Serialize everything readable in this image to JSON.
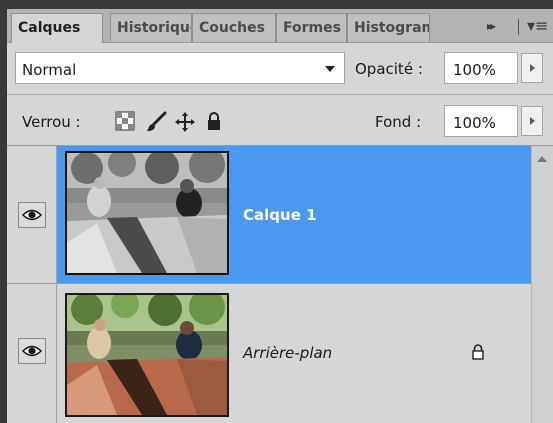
{
  "tabs": [
    {
      "label": "Calques"
    },
    {
      "label": "Historique"
    },
    {
      "label": "Couches"
    },
    {
      "label": "Formes"
    },
    {
      "label": "Histogramme"
    }
  ],
  "tab_controls": {
    "collapse": "▸▸",
    "menu": "▾≡"
  },
  "blend": {
    "mode": "Normal",
    "opacity_label": "Opacité :",
    "opacity_value": "100%"
  },
  "lock": {
    "label": "Verrou :",
    "icons": [
      "lock-transparency-icon",
      "lock-pixels-brush-icon",
      "lock-position-move-icon",
      "lock-all-padlock-icon"
    ]
  },
  "fill": {
    "label": "Fond :",
    "value": "100%"
  },
  "layers": [
    {
      "name": "Calque 1",
      "selected": true,
      "visible": true,
      "thumbnail": "grayscale-photo-table-scene"
    },
    {
      "name": "Arrière-plan",
      "selected": false,
      "visible": true,
      "locked": true,
      "thumbnail": "color-photo-table-scene"
    }
  ],
  "colors": {
    "selection": "#4a99ee",
    "panel_bg": "#d6d6d6"
  }
}
